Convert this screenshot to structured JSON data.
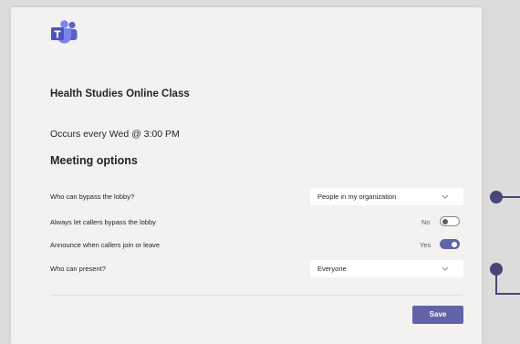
{
  "app": {
    "logo_icon": "microsoft-teams-logo",
    "accent_color": "#6264a7"
  },
  "meeting": {
    "title": "Health Studies Online Class",
    "schedule": "Occurs every Wed @ 3:00 PM"
  },
  "options": {
    "heading": "Meeting options",
    "lobby_bypass": {
      "label": "Who can bypass the lobby?",
      "value": "People in my organization"
    },
    "callers_bypass": {
      "label": "Always let callers bypass the lobby",
      "state_text": "No",
      "on": false
    },
    "announce_callers": {
      "label": "Announce when callers join or leave",
      "state_text": "Yes",
      "on": true
    },
    "presenters": {
      "label": "Who can present?",
      "value": "Everyone"
    }
  },
  "footer": {
    "save_label": "Save"
  }
}
